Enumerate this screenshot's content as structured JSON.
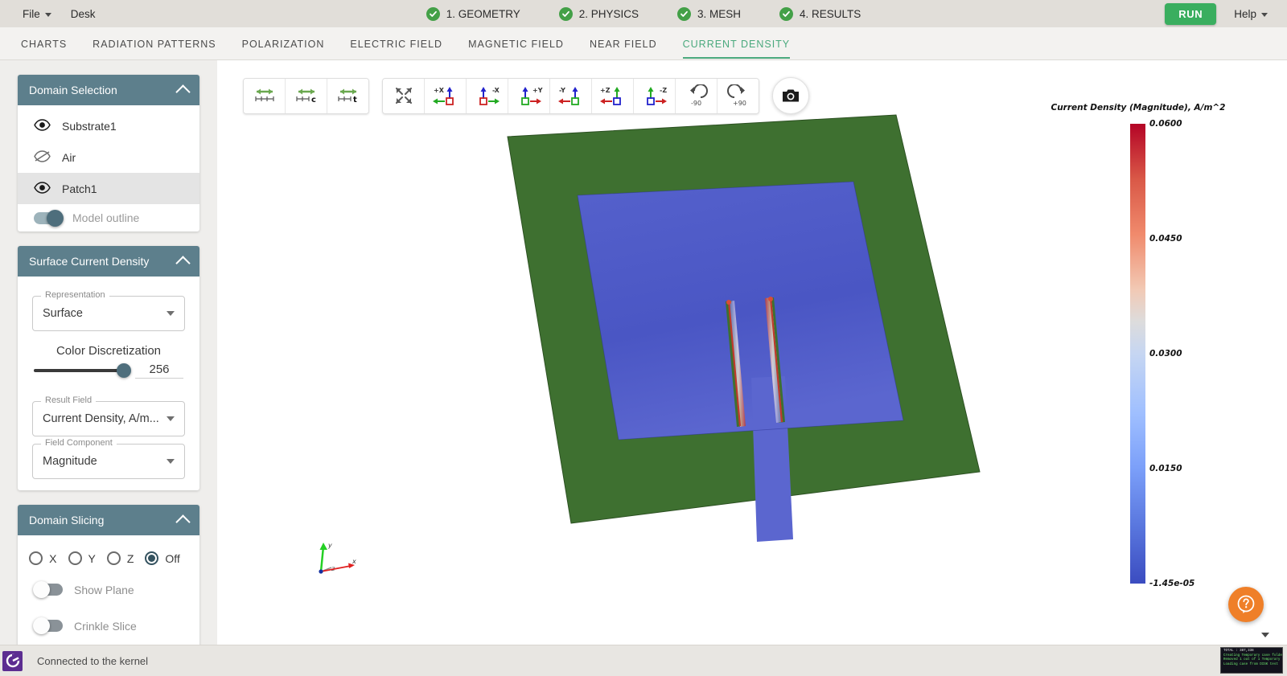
{
  "menubar": {
    "items": [
      {
        "label": "File",
        "has_caret": true
      },
      {
        "label": "Desk",
        "has_caret": false
      }
    ],
    "steps": [
      {
        "label": "1. GEOMETRY",
        "state": "complete"
      },
      {
        "label": "2. PHYSICS",
        "state": "complete"
      },
      {
        "label": "3. MESH",
        "state": "complete"
      },
      {
        "label": "4. RESULTS",
        "state": "complete"
      }
    ],
    "run_label": "RUN",
    "help_label": "Help",
    "check_color": "#43a047",
    "run_color": "#3aae5f"
  },
  "tabs": [
    {
      "label": "CHARTS",
      "active": false
    },
    {
      "label": "RADIATION PATTERNS",
      "active": false
    },
    {
      "label": "POLARIZATION",
      "active": false
    },
    {
      "label": "ELECTRIC FIELD",
      "active": false
    },
    {
      "label": "MAGNETIC FIELD",
      "active": false
    },
    {
      "label": "NEAR FIELD",
      "active": false
    },
    {
      "label": "CURRENT DENSITY",
      "active": true
    }
  ],
  "tab_active_color": "#4aa97d",
  "sidebar": {
    "panels": {
      "domain_selection": {
        "title": "Domain Selection",
        "collapsed": false,
        "domains": [
          {
            "label": "Substrate1",
            "visible": true,
            "selected": false
          },
          {
            "label": "Air",
            "visible": false,
            "selected": false
          },
          {
            "label": "Patch1",
            "visible": true,
            "selected": true
          }
        ],
        "model_outline": {
          "label": "Model outline",
          "on": true
        }
      },
      "surface_current_density": {
        "title": "Surface Current Density",
        "collapsed": false,
        "representation": {
          "legend": "Representation",
          "value": "Surface"
        },
        "color_discretization": {
          "label": "Color Discretization",
          "value": "256",
          "percent": 100
        },
        "result_field": {
          "legend": "Result Field",
          "value": "Current Density, A/m..."
        },
        "field_component": {
          "legend": "Field Component",
          "value": "Magnitude"
        }
      },
      "domain_slicing": {
        "title": "Domain Slicing",
        "collapsed": false,
        "axis_options": [
          {
            "label": "X",
            "selected": false
          },
          {
            "label": "Y",
            "selected": false
          },
          {
            "label": "Z",
            "selected": false
          },
          {
            "label": "Off",
            "selected": true
          }
        ],
        "show_plane": {
          "label": "Show Plane",
          "on": false
        },
        "crinkle_slice": {
          "label": "Crinkle Slice",
          "on": false
        }
      }
    },
    "panel_header_color": "#5d7f8c"
  },
  "viewport": {
    "toolbar": {
      "groups": [
        [
          {
            "name": "scale-axes",
            "label": ""
          },
          {
            "name": "scale-axes-c",
            "label": "c"
          },
          {
            "name": "scale-axes-t",
            "label": "t"
          }
        ],
        [
          {
            "name": "fit-to-view",
            "label": ""
          },
          {
            "name": "view-plus-x",
            "label": "+X"
          },
          {
            "name": "view-minus-x",
            "label": "-X"
          },
          {
            "name": "view-plus-y",
            "label": "+Y"
          },
          {
            "name": "view-minus-y",
            "label": "-Y"
          },
          {
            "name": "view-plus-z",
            "label": "+Z"
          },
          {
            "name": "view-minus-z",
            "label": "-Z"
          },
          {
            "name": "rotate-ccw",
            "label": "-90"
          },
          {
            "name": "rotate-cw",
            "label": "+90"
          }
        ]
      ],
      "camera_label": "Screenshot"
    },
    "axis_triad": {
      "x": "x",
      "y": "y",
      "z": "z"
    },
    "help_button": "?"
  },
  "chart_data": {
    "type": "heatmap",
    "title": "Current Density (Magnitude), A/m^2",
    "colormap": "coolwarm",
    "min": -1.45e-05,
    "max": 0.06,
    "tick_labels": [
      "0.0600",
      "0.0450",
      "0.0300",
      "0.0150",
      "-1.45e-05"
    ],
    "tick_values": [
      0.06,
      0.045,
      0.03,
      0.015,
      -1.45e-05
    ],
    "colorbar_position": "right",
    "field": "Current Density",
    "component": "Magnitude",
    "unit": "A/m^2",
    "geometry": {
      "substrate_color": "#477a35",
      "patch_color": "#4a56c4",
      "hotspot_color": "#c0392b",
      "description": "Inset-fed rectangular microstrip patch antenna on green substrate with blue patch and red high-current-density edges along the inset feed slots"
    }
  },
  "statusbar": {
    "logo": "C",
    "message": "Connected to the kernel",
    "terminal_lines": [
      "TOTAL : 387,338",
      "Creating Temporary case folder",
      "Removed 1 out of 1 Temporary",
      "Loading case from DISK test"
    ]
  }
}
